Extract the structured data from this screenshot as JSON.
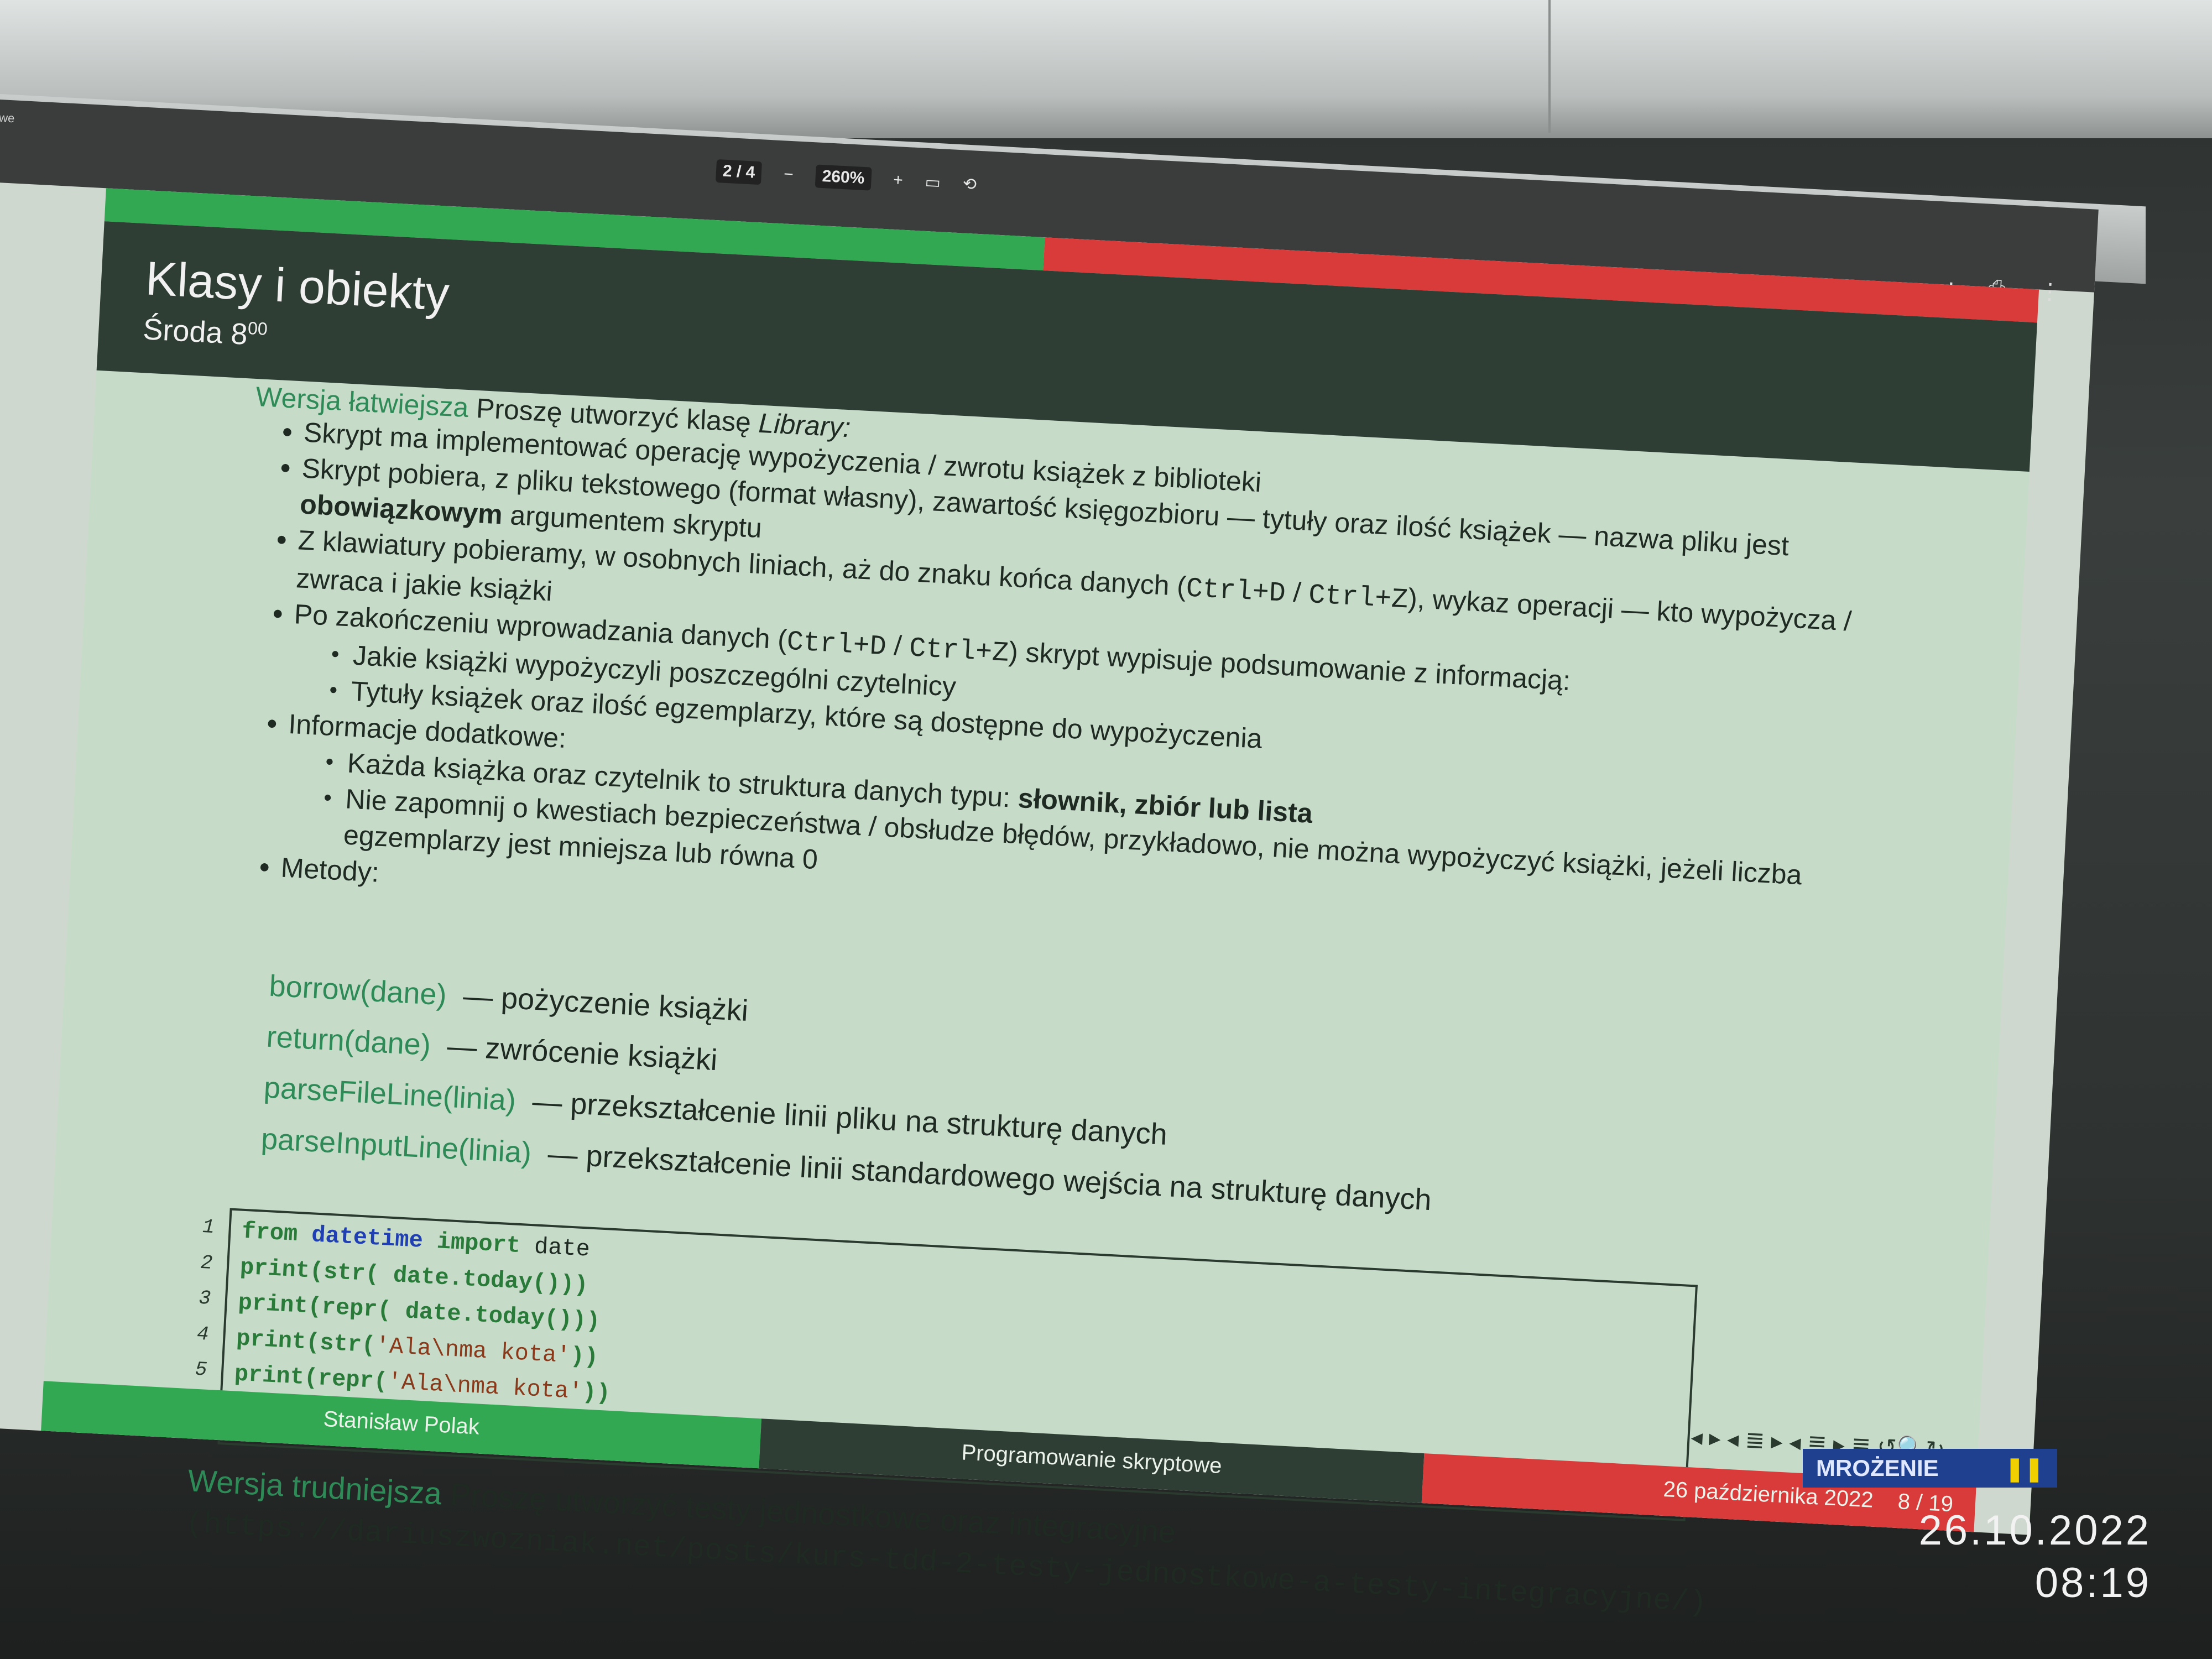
{
  "pdf_viewer": {
    "app_name": "we",
    "page_indicator": "2 / 4",
    "zoom": "260%",
    "zoom_out": "−",
    "zoom_in": "+",
    "fit_icon": "fit-page-icon",
    "rotate_icon": "rotate-icon",
    "download_icon": "download-icon",
    "print_icon": "print-icon",
    "more_icon": "more-vertical-icon",
    "download_glyph": "⭳",
    "print_glyph": "⎙",
    "more_glyph": "⋮",
    "fit_glyph": "▭",
    "rotate_glyph": "⟲"
  },
  "slide": {
    "title": "Klasy i obiekty",
    "subtitle_main": "Środa 8",
    "subtitle_sup": "00",
    "lead_label": "Wersja łatwiejsza",
    "lead_text": "Proszę utworzyć klasę",
    "lead_class": "Library:",
    "bullets": [
      "Skrypt ma implementować operację wypożyczenia / zwrotu książek z biblioteki",
      "Skrypt pobiera, z pliku tekstowego (format własny), zawartość księgozbioru — tytuły oraz ilość książek — nazwa pliku jest",
      "Z klawiatury pobieramy, w osobnych liniach, aż do znaku końca danych (",
      "Po zakończeniu wprowadzania danych (",
      "Informacje dodatkowe:",
      "Metody:"
    ],
    "bullet2_bold": "obowiązkowym",
    "bullet2_tail": "argumentem skryptu",
    "bullet3_code1": "Ctrl+D",
    "bullet3_sep": " / ",
    "bullet3_code2": "Ctrl+Z",
    "bullet3_tail": "), wykaz operacji — kto wypożycza / zwraca i jakie książki",
    "bullet4_code1": "Ctrl+D",
    "bullet4_sep": " / ",
    "bullet4_code2": "Ctrl+Z",
    "bullet4_tail": ") skrypt wypisuje podsumowanie z informacją:",
    "sub_summary": [
      "Jakie książki wypożyczyli poszczególni czytelnicy",
      "Tytuły książek oraz ilość egzemplarzy, które są dostępne do wypożyczenia"
    ],
    "sub_info_1": "Każda książka oraz czytelnik to struktura danych typu:",
    "sub_info_1_bold": "słownik, zbiór lub lista",
    "sub_info_2": "Nie zapomnij o kwestiach bezpieczeństwa / obsłudze błędów, przykładowo, nie można wypożyczyć książki, jeżeli liczba egzemplarzy jest mniejsza lub równa 0",
    "methods": [
      {
        "name": "borrow(dane)",
        "desc": "— pożyczenie książki"
      },
      {
        "name": "return(dane)",
        "desc": "— zwrócenie książki"
      },
      {
        "name": "parseFileLine(linia)",
        "desc": "— przekształcenie linii pliku na strukturę danych"
      },
      {
        "name": "parseInputLine(linia)",
        "desc": "— przekształcenie linii standardowego wejścia na strukturę danych"
      }
    ],
    "code": {
      "line_numbers": [
        "1",
        "2",
        "3",
        "4",
        "5"
      ],
      "l1_from": "from",
      "l1_mod": "datetime",
      "l1_import": "import",
      "l1_name": "date",
      "l2": "print(str( date.today()))",
      "l3": "print(repr( date.today()))",
      "l4_pre": "print(str(",
      "l4_str": "'Ala\\nma kota'",
      "l4_post": "))",
      "l5_pre": "print(repr(",
      "l5_str": "'Ala\\nma kota'",
      "l5_post": "))"
    },
    "harder_label": "Wersja trudniejsza",
    "harder_text": "Proszę utworzyć testy jednostkowe oraz integracyjne",
    "url": "(https://dariuszwozniak.net/posts/kurs-tdd-2-testy-jednostkowe-a-testy-integracyjne/)",
    "nav_glyphs": "◂ ▸ ◂ ≣ ▸ ◂ ≣ ▸  ≣  ↺🔍↻",
    "footer_author": "Stanisław Polak",
    "footer_course": "Programowanie skryptowe",
    "footer_date": "26 października 2022",
    "footer_page": "8 / 19"
  },
  "freeze": {
    "label": "MROŻENIE",
    "icon": "pause-icon",
    "glyph": "❚❚"
  },
  "photo_stamp": {
    "date": "26.10.2022",
    "time": "08:19"
  },
  "colors": {
    "green": "#33a852",
    "red": "#d93a3a",
    "header": "#2f3e34",
    "slide_bg": "#c6dcc9",
    "freeze_bg": "#1f3f8f"
  }
}
